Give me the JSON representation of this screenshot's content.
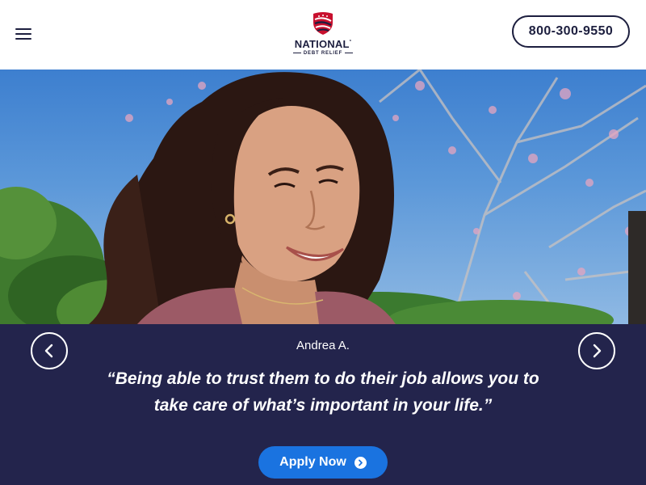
{
  "header": {
    "menu_icon": "hamburger-menu-icon",
    "logo": {
      "wordmark": "NATIONAL",
      "superscript": "°",
      "tagline": "DEBT RELIEF",
      "icon": "flag-shield-icon"
    },
    "phone_label": "800-300-9550"
  },
  "hero": {
    "image_subject": "smiling woman with curly hair outdoors"
  },
  "testimonial": {
    "reviewer": "Andrea A.",
    "quote": "“Being able to trust them to do their job allows you to take care of what’s important in your life.”",
    "prev_icon": "chevron-left-icon",
    "next_icon": "chevron-right-icon"
  },
  "cta": {
    "label": "Apply Now",
    "icon": "chevron-right-circle-icon"
  },
  "colors": {
    "navy": "#23244c",
    "brand_blue": "#1a73e0",
    "logo_red": "#c8102e",
    "text_dark": "#1d1f3f"
  }
}
